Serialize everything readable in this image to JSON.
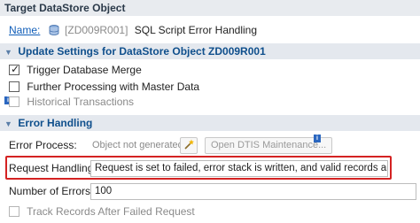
{
  "header": {
    "title": "Target DataStore Object"
  },
  "target": {
    "name_link": "Name:",
    "object_id": "[ZD009R001]",
    "object_desc": "SQL Script Error Handling"
  },
  "update_settings": {
    "title": "Update Settings for DataStore Object ZD009R001",
    "trigger_merge": {
      "label": "Trigger Database Merge",
      "checked": true
    },
    "further_processing": {
      "label": "Further Processing with Master Data",
      "checked": false
    },
    "historical": {
      "label": "Historical Transactions",
      "checked": false,
      "enabled": false
    }
  },
  "error_handling": {
    "title": "Error Handling",
    "error_process_label": "Error Process:",
    "error_process_value": "Object not generated",
    "open_dtis_button": "Open DTIS Maintenance...",
    "request_handling_label": "Request Handling:",
    "request_handling_value": "Request is set to failed, error stack is written, and valid records are updated",
    "errors_label": "Number of Errors:",
    "errors_value": "100",
    "track_records": {
      "label": "Track Records After Failed Request",
      "checked": false,
      "enabled": false
    }
  },
  "icons": {
    "caret": "caret-down-icon",
    "db": "database-icon",
    "info": "info-icon",
    "wand": "wand-icon"
  },
  "colors": {
    "section_title": "#0f4f8c",
    "link": "#0f5db8",
    "highlight": "#d42222"
  }
}
